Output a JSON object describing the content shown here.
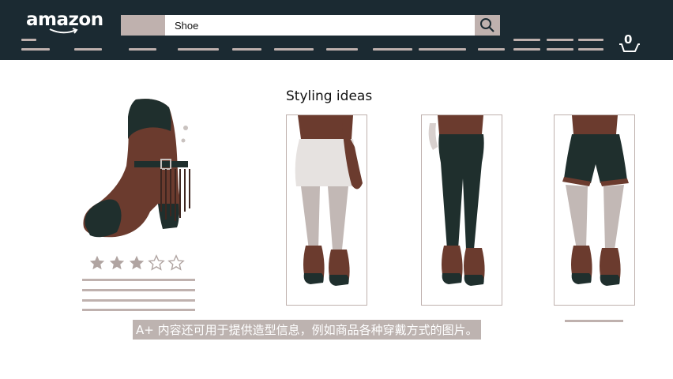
{
  "header": {
    "logo_text": "amazon",
    "search": {
      "value": "Shoe",
      "icon": "search-icon"
    },
    "cart": {
      "count": "0",
      "icon": "cart-icon"
    }
  },
  "product": {
    "image": "brown-fringe-ankle-boot",
    "rating": 3,
    "rating_max": 5
  },
  "styling": {
    "heading": "Styling ideas",
    "looks": [
      {
        "image": "outfit-lace-skirt-with-bag"
      },
      {
        "image": "outfit-dark-skinny-pants"
      },
      {
        "image": "outfit-dark-shorts"
      }
    ]
  },
  "subtitle": "A+ 内容还可用于提供造型信息，例如商品各种穿戴方式的图片。",
  "colors": {
    "header_bg": "#1b2a32",
    "placeholder_gray": "#bfb1ae",
    "boot_brown": "#6b3b2e",
    "dark_teal": "#1f2f2d"
  }
}
